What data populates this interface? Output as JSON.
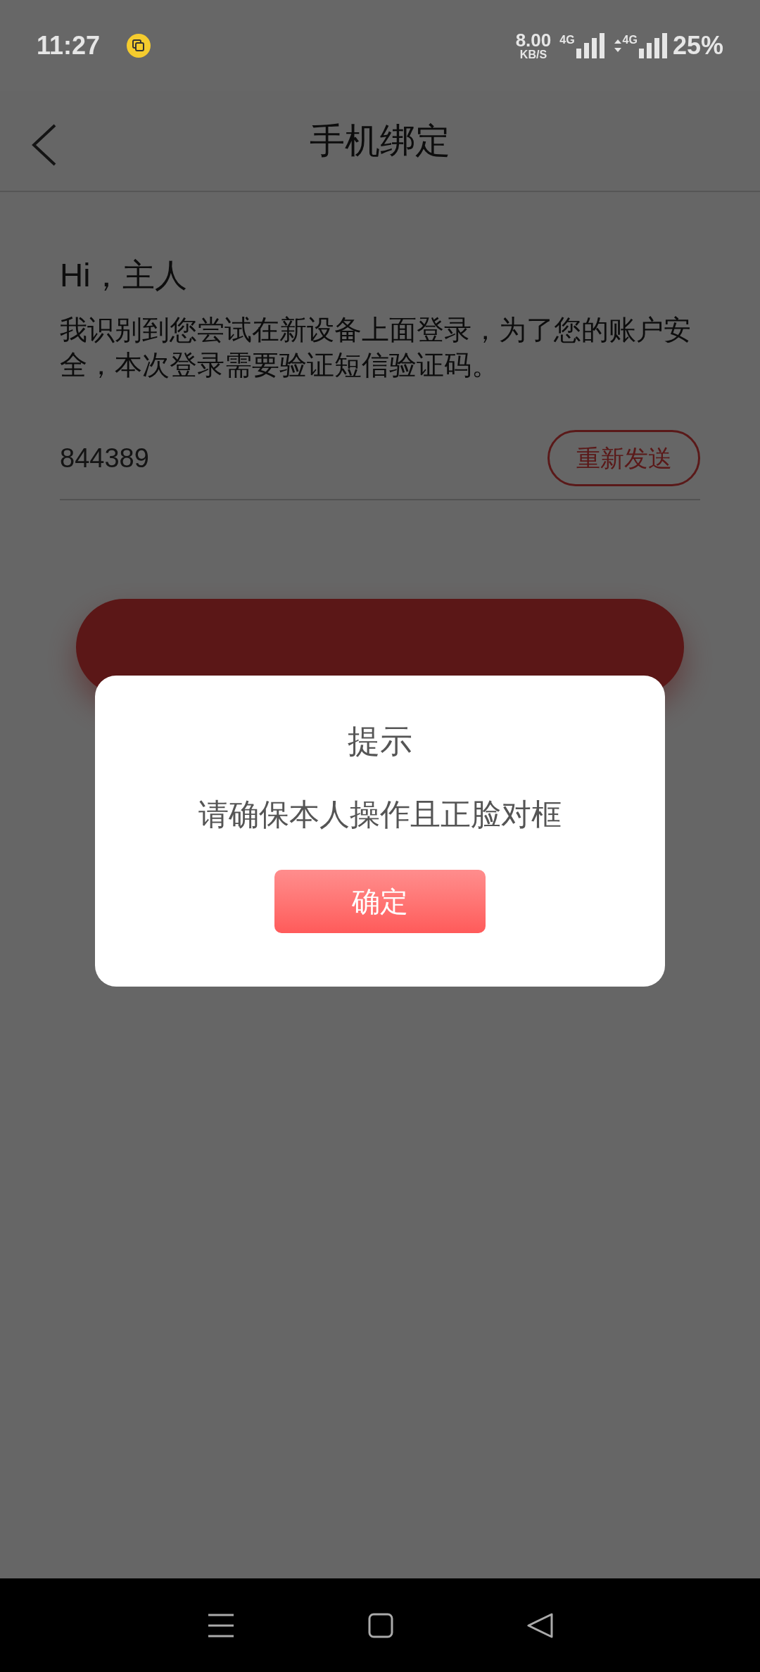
{
  "status_bar": {
    "time": "11:27",
    "network_speed": "8.00",
    "speed_unit": "KB/S",
    "sim_1": "4G",
    "sim_2": "4G",
    "battery": "25%"
  },
  "header": {
    "title": "手机绑定"
  },
  "greeting": "Hi，主人",
  "message": "我识别到您尝试在新设备上面登录，为了您的账户安全，本次登录需要验证短信验证码。",
  "code_field": {
    "value": "844389"
  },
  "resend_button": "重新发送",
  "dialog": {
    "title": "提示",
    "message": "请确保本人操作且正脸对框",
    "confirm_button": "确定"
  }
}
